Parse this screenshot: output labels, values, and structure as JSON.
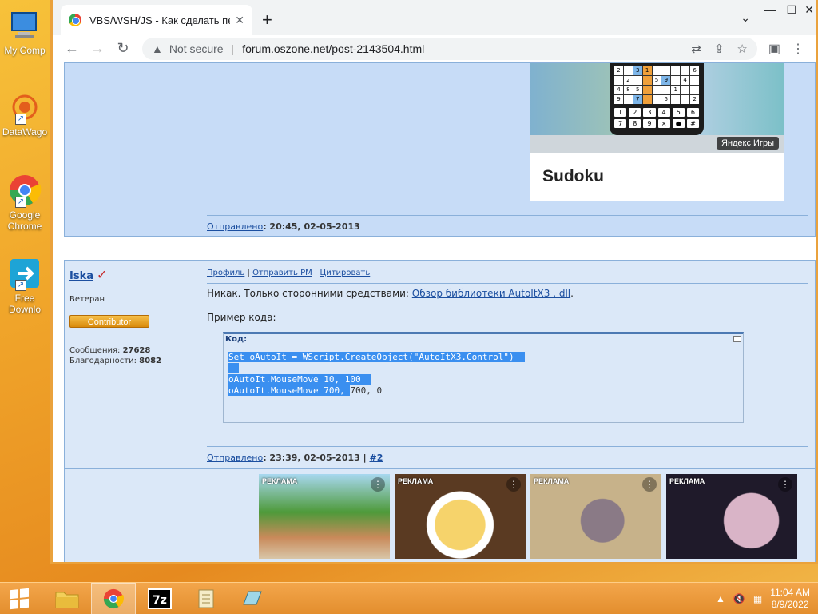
{
  "desktop": {
    "icons": [
      {
        "label": "My Comp"
      },
      {
        "label": "DataWago"
      },
      {
        "label": "Google Chrome"
      },
      {
        "label": "Free Downlo"
      }
    ]
  },
  "browser": {
    "tab_title": "VBS/WSH/JS - Как сделать пере",
    "address": {
      "security_text": "Not secure",
      "url": "forum.oszone.net/post-2143504.html"
    }
  },
  "post1": {
    "ad": {
      "title": "Sudoku",
      "badge": "Яндекс Игры",
      "grid": [
        "2",
        "",
        "3",
        "1",
        "",
        "",
        "",
        "",
        "6",
        "",
        "2",
        "",
        "",
        "5",
        "9",
        "",
        "4",
        "",
        "4",
        "8",
        "5",
        "",
        "",
        "",
        "1",
        "",
        "",
        "9",
        "",
        "7",
        "",
        "",
        "5",
        "",
        "",
        "2"
      ],
      "keys": [
        "1",
        "2",
        "3",
        "4",
        "5",
        "6",
        "7",
        "8",
        "9",
        "×",
        "●",
        "#"
      ]
    },
    "sent_label": "Отправлено",
    "sent_time": ": 20:45, 02-05-2013"
  },
  "post2": {
    "author": {
      "name": "Iska",
      "rank": "Ветеран",
      "badge": "Contributor",
      "messages_label": "Сообщения: ",
      "messages": "27628",
      "thanks_label": "Благодарности: ",
      "thanks": "8082"
    },
    "links": {
      "profile": "Профиль",
      "pm": "Отправить PM",
      "quote": "Цитировать"
    },
    "text_prefix": "Никак. Только сторонними средствами: ",
    "text_link": "Обзор библиотеки AutoItX3 . dll",
    "text_suffix": ".",
    "example_label": "Пример кода:",
    "code": {
      "header": "Код:",
      "line1": "Set oAutoIt = WScript.CreateObject(\"AutoItX3.Control\")",
      "line3": "oAutoIt.MouseMove 10, 100",
      "line4_sel": "oAutoIt.MouseMove 700, ",
      "line4_rest": "700, 0"
    },
    "sent_label": "Отправлено",
    "sent_time": ": 23:39, 02-05-2013 | ",
    "post_num": "#2"
  },
  "ads": {
    "tag": "РЕКЛАМА",
    "items": [
      {
        "id": 1
      },
      {
        "id": 2
      },
      {
        "id": 3
      },
      {
        "id": 4
      }
    ]
  },
  "taskbar": {
    "time": "11:04 AM",
    "date": "8/9/2022"
  }
}
